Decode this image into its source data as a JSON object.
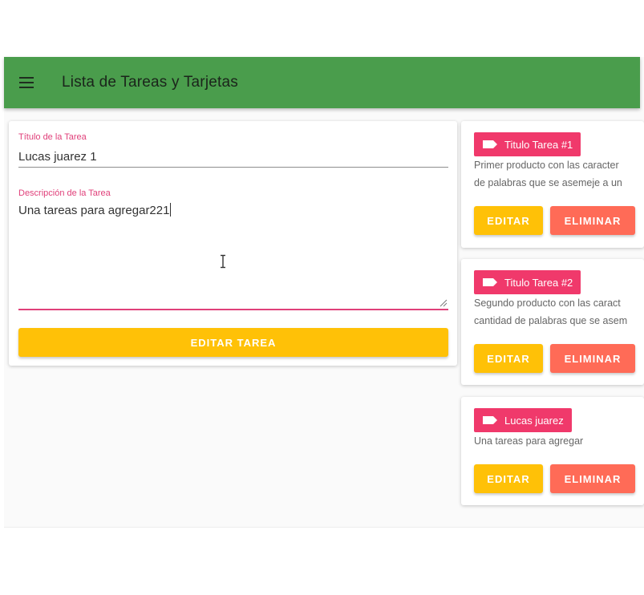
{
  "appbar": {
    "title": "Lista de Tareas y Tarjetas"
  },
  "icons": {
    "menu": "menu-icon",
    "label": "label-icon",
    "text_cursor": "text-cursor-icon"
  },
  "colors": {
    "appbar": "#4a9d4c",
    "accent_pink": "#e0407a",
    "tag": "#f0396b",
    "edit_button": "#ffc107",
    "delete_button": "#ff6b57"
  },
  "form": {
    "title_label": "Título de la Tarea",
    "title_value": "Lucas juarez 1",
    "description_label": "Descripción de la Tarea",
    "description_value": "Una tareas para agregar221",
    "submit_label": "EDITAR TAREA"
  },
  "tasks": [
    {
      "title": "Titulo Tarea #1",
      "description_lines": [
        "Primer producto con las caracter",
        "de palabras que se asemeje a un"
      ],
      "edit_label": "EDITAR",
      "delete_label": "ELIMINAR"
    },
    {
      "title": "Titulo Tarea #2",
      "description_lines": [
        "Segundo producto con las caract",
        "cantidad de palabras que se asem"
      ],
      "edit_label": "EDITAR",
      "delete_label": "ELIMINAR"
    },
    {
      "title": "Lucas juarez",
      "description_lines": [
        "Una tareas para agregar"
      ],
      "edit_label": "EDITAR",
      "delete_label": "ELIMINAR"
    }
  ]
}
